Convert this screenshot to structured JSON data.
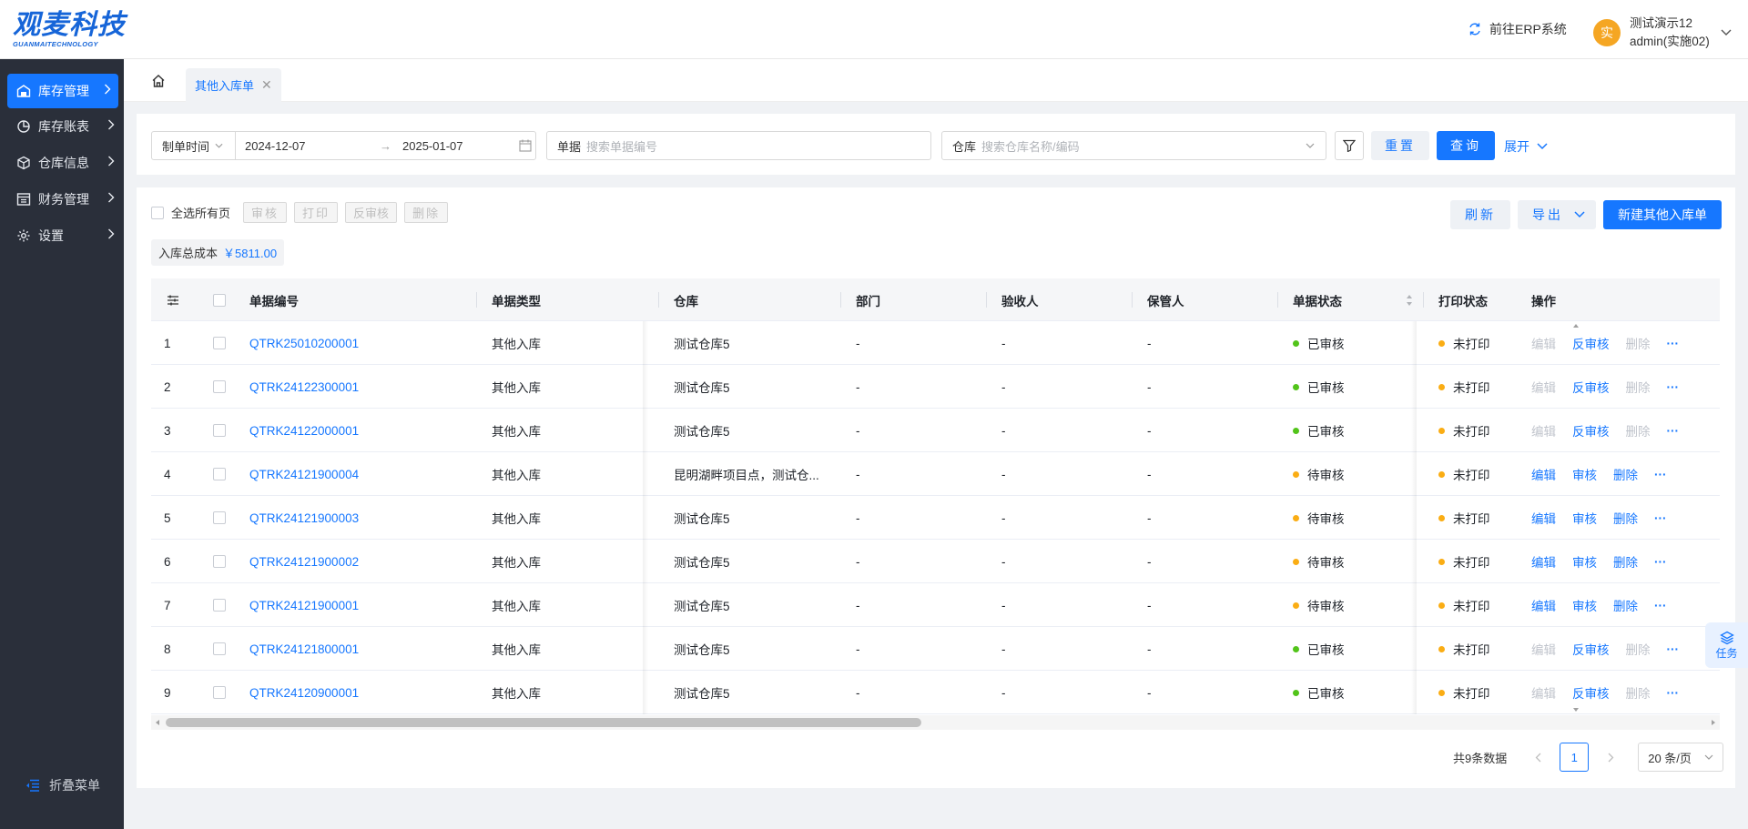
{
  "brand": {
    "logo_main": "观麦科技",
    "logo_sub": "GUANMAITECHNOLOGY"
  },
  "header": {
    "erp_link": "前往ERP系统",
    "avatar_char": "实",
    "user_name": "测试演示12",
    "user_account": "admin(实施02)"
  },
  "sidebar": {
    "items": [
      {
        "label": "库存管理",
        "icon": "warehouse-icon"
      },
      {
        "label": "库存账表",
        "icon": "pie-chart-icon"
      },
      {
        "label": "仓库信息",
        "icon": "cube-icon"
      },
      {
        "label": "财务管理",
        "icon": "finance-icon"
      },
      {
        "label": "设置",
        "icon": "gear-icon"
      }
    ],
    "collapse_label": "折叠菜单"
  },
  "tabs": {
    "active_label": "其他入库单"
  },
  "filters": {
    "date_type": "制单时间",
    "date_start": "2024-12-07",
    "date_end": "2025-01-07",
    "doc_label": "单据",
    "doc_placeholder": "搜索单据编号",
    "wh_label": "仓库",
    "wh_placeholder": "搜索仓库名称/编码",
    "reset": "重置",
    "query": "查询",
    "expand": "展开"
  },
  "toolbar": {
    "select_all": "全选所有页",
    "approve": "审核",
    "print": "打印",
    "unapprove": "反审核",
    "delete": "删除",
    "refresh": "刷新",
    "export": "导出",
    "new": "新建其他入库单"
  },
  "summary": {
    "label": "入库总成本",
    "value": "￥5811.00"
  },
  "table": {
    "columns": [
      "单据编号",
      "单据类型",
      "仓库",
      "部门",
      "验收人",
      "保管人",
      "单据状态",
      "打印状态",
      "操作"
    ],
    "rows": [
      {
        "idx": "1",
        "code": "QTRK25010200001",
        "type": "其他入库",
        "warehouse": "测试仓库5",
        "dept": "-",
        "receiver": "-",
        "keeper": "-",
        "status": "已审核",
        "status_color": "#52c41a",
        "print": "未打印",
        "print_color": "#faad14",
        "ops": [
          "编辑",
          "反审核",
          "删除"
        ],
        "ops_enabled": [
          false,
          true,
          false
        ]
      },
      {
        "idx": "2",
        "code": "QTRK24122300001",
        "type": "其他入库",
        "warehouse": "测试仓库5",
        "dept": "-",
        "receiver": "-",
        "keeper": "-",
        "status": "已审核",
        "status_color": "#52c41a",
        "print": "未打印",
        "print_color": "#faad14",
        "ops": [
          "编辑",
          "反审核",
          "删除"
        ],
        "ops_enabled": [
          false,
          true,
          false
        ]
      },
      {
        "idx": "3",
        "code": "QTRK24122000001",
        "type": "其他入库",
        "warehouse": "测试仓库5",
        "dept": "-",
        "receiver": "-",
        "keeper": "-",
        "status": "已审核",
        "status_color": "#52c41a",
        "print": "未打印",
        "print_color": "#faad14",
        "ops": [
          "编辑",
          "反审核",
          "删除"
        ],
        "ops_enabled": [
          false,
          true,
          false
        ]
      },
      {
        "idx": "4",
        "code": "QTRK24121900004",
        "type": "其他入库",
        "warehouse": "昆明湖畔项目点，测试仓...",
        "dept": "-",
        "receiver": "-",
        "keeper": "-",
        "status": "待审核",
        "status_color": "#faad14",
        "print": "未打印",
        "print_color": "#faad14",
        "ops": [
          "编辑",
          "审核",
          "删除"
        ],
        "ops_enabled": [
          true,
          true,
          true
        ]
      },
      {
        "idx": "5",
        "code": "QTRK24121900003",
        "type": "其他入库",
        "warehouse": "测试仓库5",
        "dept": "-",
        "receiver": "-",
        "keeper": "-",
        "status": "待审核",
        "status_color": "#faad14",
        "print": "未打印",
        "print_color": "#faad14",
        "ops": [
          "编辑",
          "审核",
          "删除"
        ],
        "ops_enabled": [
          true,
          true,
          true
        ]
      },
      {
        "idx": "6",
        "code": "QTRK24121900002",
        "type": "其他入库",
        "warehouse": "测试仓库5",
        "dept": "-",
        "receiver": "-",
        "keeper": "-",
        "status": "待审核",
        "status_color": "#faad14",
        "print": "未打印",
        "print_color": "#faad14",
        "ops": [
          "编辑",
          "审核",
          "删除"
        ],
        "ops_enabled": [
          true,
          true,
          true
        ]
      },
      {
        "idx": "7",
        "code": "QTRK24121900001",
        "type": "其他入库",
        "warehouse": "测试仓库5",
        "dept": "-",
        "receiver": "-",
        "keeper": "-",
        "status": "待审核",
        "status_color": "#faad14",
        "print": "未打印",
        "print_color": "#faad14",
        "ops": [
          "编辑",
          "审核",
          "删除"
        ],
        "ops_enabled": [
          true,
          true,
          true
        ]
      },
      {
        "idx": "8",
        "code": "QTRK24121800001",
        "type": "其他入库",
        "warehouse": "测试仓库5",
        "dept": "-",
        "receiver": "-",
        "keeper": "-",
        "status": "已审核",
        "status_color": "#52c41a",
        "print": "未打印",
        "print_color": "#faad14",
        "ops": [
          "编辑",
          "反审核",
          "删除"
        ],
        "ops_enabled": [
          false,
          true,
          false
        ]
      },
      {
        "idx": "9",
        "code": "QTRK24120900001",
        "type": "其他入库",
        "warehouse": "测试仓库5",
        "dept": "-",
        "receiver": "-",
        "keeper": "-",
        "status": "已审核",
        "status_color": "#52c41a",
        "print": "未打印",
        "print_color": "#faad14",
        "ops": [
          "编辑",
          "反审核",
          "删除"
        ],
        "ops_enabled": [
          false,
          true,
          false
        ]
      }
    ]
  },
  "pagination": {
    "total": "共9条数据",
    "current": "1",
    "page_size": "20 条/页"
  },
  "task_float": {
    "label": "任务"
  },
  "colors": {
    "primary": "#1677ff",
    "sidebar_bg": "#2a2f3a",
    "approved": "#52c41a",
    "pending": "#faad14"
  }
}
